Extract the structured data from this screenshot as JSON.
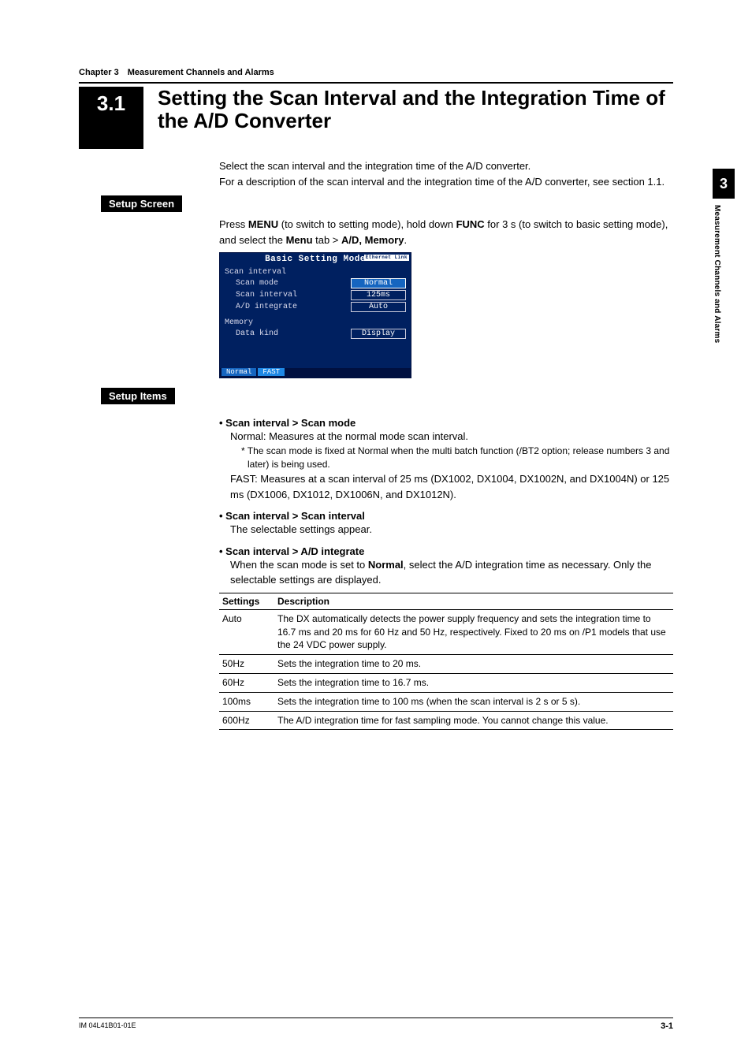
{
  "side_tab": {
    "chapter_num": "3",
    "chapter_title": "Measurement Channels and Alarms"
  },
  "chapter_line": "Chapter 3 Measurement Channels and Alarms",
  "title_num": "3.1",
  "title_text": "Setting the Scan Interval and the Integration Time of the A/D Converter",
  "intro": {
    "p1": "Select the scan interval and the integration time of the A/D converter.",
    "p2": "For a description of the scan interval and the integration time of the A/D converter, see section 1.1."
  },
  "labels": {
    "setup_screen": "Setup Screen",
    "setup_items": "Setup Items"
  },
  "setup_instr": {
    "pre1": "Press ",
    "menu": "MENU",
    "mid1": " (to switch to setting mode), hold down ",
    "func": "FUNC",
    "mid2": " for 3 s (to switch to basic setting mode), and select the ",
    "menu_tab": "Menu",
    "mid3": " tab > ",
    "dest": "A/D, Memory",
    "end": "."
  },
  "screenshot": {
    "title": "Basic Setting Mode",
    "badge": "Ethernet Link",
    "group1_label": "Scan interval",
    "rows1": [
      {
        "label": "Scan mode",
        "value": "Normal",
        "active": true
      },
      {
        "label": "Scan interval",
        "value": "125ms",
        "active": false
      },
      {
        "label": "A/D integrate",
        "value": "Auto",
        "active": false
      }
    ],
    "group2_label": "Memory",
    "rows2": [
      {
        "label": "Data kind",
        "value": "Display",
        "active": false
      }
    ],
    "footer_opts": [
      "Normal",
      "FAST"
    ]
  },
  "items": [
    {
      "head": "Scan interval > Scan mode",
      "body1": "Normal: Measures at the normal mode scan interval.",
      "footnote": "* The scan mode is fixed at Normal when the multi batch function (/BT2 option; release numbers 3 and later) is being used.",
      "body2": "FAST: Measures at a scan interval of 25 ms (DX1002, DX1004, DX1002N, and DX1004N) or 125 ms (DX1006, DX1012, DX1006N, and DX1012N)."
    },
    {
      "head": "Scan interval > Scan interval",
      "body1": "The selectable settings appear."
    },
    {
      "head": "Scan interval > A/D integrate",
      "body1_pre": "When the scan mode is set to ",
      "body1_bold": "Normal",
      "body1_post": ", select the A/D integration time as necessary. Only the selectable settings are displayed."
    }
  ],
  "table": {
    "headers": [
      "Settings",
      "Description"
    ],
    "rows": [
      [
        "Auto",
        "The DX automatically detects the power supply frequency and sets the integration time to 16.7 ms and 20 ms for 60 Hz and 50 Hz, respectively. Fixed to 20 ms on /P1 models that use the 24 VDC power supply."
      ],
      [
        "50Hz",
        "Sets the integration time to 20 ms."
      ],
      [
        "60Hz",
        "Sets the integration time to 16.7 ms."
      ],
      [
        "100ms",
        "Sets the integration time to 100 ms (when the scan interval is 2 s or 5 s)."
      ],
      [
        "600Hz",
        "The A/D integration time for fast sampling mode. You cannot change this value."
      ]
    ]
  },
  "footer": {
    "left": "IM 04L41B01-01E",
    "right": "3-1"
  }
}
